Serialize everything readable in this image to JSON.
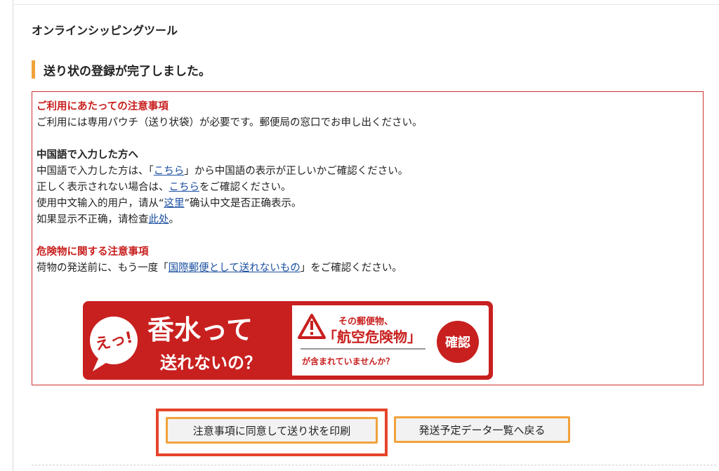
{
  "header": {
    "app_title": "オンラインシッピングツール"
  },
  "section": {
    "title": "送り状の登録が完了しました。",
    "accent_color": "#f0a23b"
  },
  "notice": {
    "usage_title": "ご利用にあたっての注意事項",
    "usage_text": "ご利用には専用パウチ（送り状袋）が必要です。郵便局の窓口でお申し出ください。",
    "chinese_title": "中国語で入力した方へ",
    "chinese_line1_pre": "中国語で入力した方は、「",
    "chinese_line1_link": "こちら",
    "chinese_line1_post": "」から中国語の表示が正しいかご確認ください。",
    "chinese_line2_pre": "正しく表示されない場合は、",
    "chinese_line2_link": "こちら",
    "chinese_line2_post": "をご確認ください。",
    "zh_line1_pre": "使用中文输入的用户，请从“",
    "zh_line1_link": "这里",
    "zh_line1_post": "”确认中文是否正确表示。",
    "zh_line2_pre": "如果显示不正确，请检查",
    "zh_line2_link": "此处",
    "zh_line2_post": "。",
    "danger_title": "危険物に関する注意事項",
    "danger_pre": "荷物の発送前に、もう一度「",
    "danger_link": "国際郵便として送れないもの",
    "danger_post": "」をご確認ください。",
    "border_color": "#cc3333",
    "title_color": "#c8201f"
  },
  "banner": {
    "bubble": "えっ!",
    "headline1": "香水って",
    "headline2": "送れないの？",
    "right_line1": "その郵便物、",
    "right_line2": "「航空危険物」",
    "right_line3": "が含まれていませんか？",
    "confirm": "確認",
    "color": "#c8201f"
  },
  "actions": {
    "print_label": "注意事項に同意して送り状を印刷",
    "back_label": "発送予定データ一覧へ戻る",
    "highlight_color": "#e6442b"
  }
}
